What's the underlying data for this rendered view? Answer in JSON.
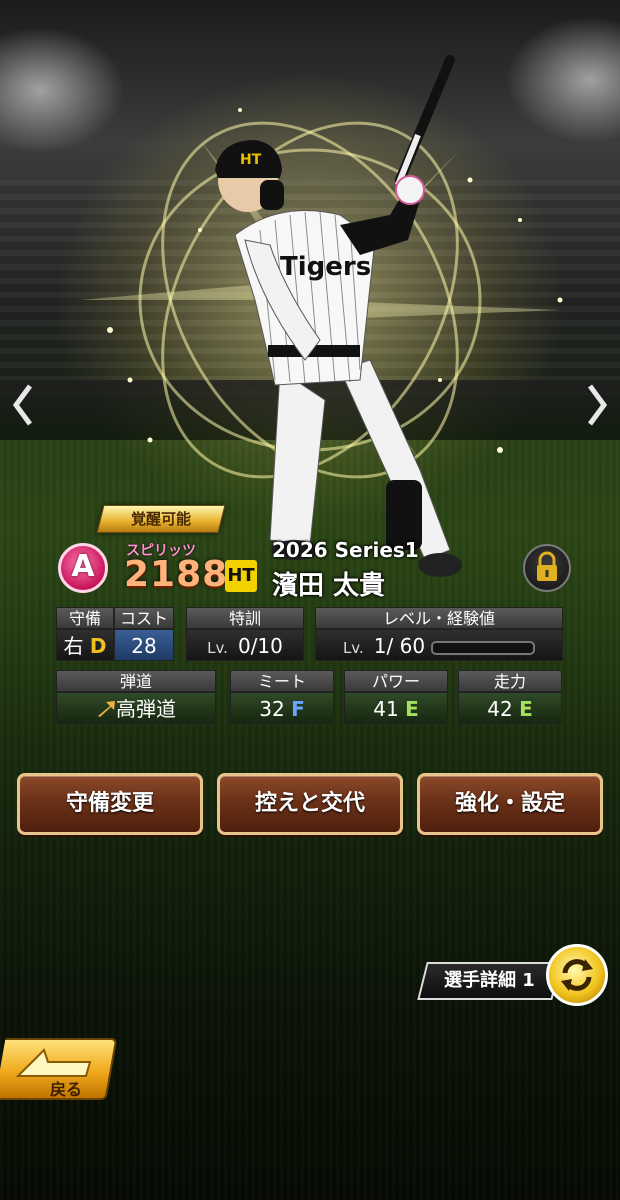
{
  "card": {
    "awaken_badge": "覚醒可能",
    "rank": "A",
    "spirits_label": "スピリッツ",
    "spirits_value": "2188",
    "team_logo": "HT",
    "series": "2026 Series1",
    "player_name": "濱田 太貴",
    "jersey_text": "Tigers"
  },
  "stats": {
    "position": {
      "label": "守備",
      "hand": "右",
      "grade": "D"
    },
    "cost": {
      "label": "コスト",
      "value": "28"
    },
    "training": {
      "label": "特訓",
      "lv": "Lv.",
      "value": "0/10"
    },
    "level": {
      "label": "レベル・経験値",
      "lv": "Lv.",
      "value": "1/ 60",
      "exp_fraction": 0
    },
    "trajectory": {
      "label": "弾道",
      "value": "高弾道"
    },
    "meet": {
      "label": "ミート",
      "value": "32",
      "grade": "F"
    },
    "power": {
      "label": "パワー",
      "value": "41",
      "grade": "E"
    },
    "speed": {
      "label": "走力",
      "value": "42",
      "grade": "E"
    }
  },
  "buttons": {
    "defense_change": "守備変更",
    "swap": "控えと交代",
    "enhance": "強化・設定"
  },
  "detail_tab": "選手詳細 1",
  "back_label": "戻る",
  "icons": {
    "left_arrow": "chevron-left-icon",
    "right_arrow": "chevron-right-icon",
    "lock": "lock-icon",
    "swap_detail": "cycle-icon",
    "back": "back-arrow-icon",
    "trajectory": "arrow-up-right-icon"
  },
  "colors": {
    "rank_pink": "#c8145b",
    "button_brown": "#6b3118",
    "gold": "#f2c51e"
  }
}
